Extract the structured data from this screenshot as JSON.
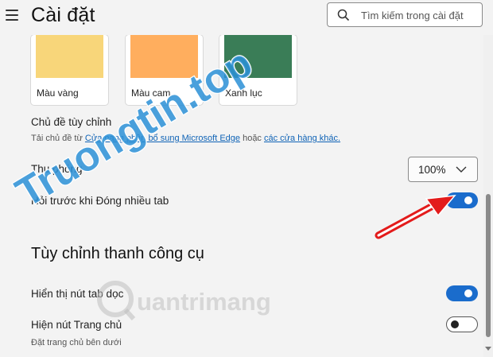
{
  "header": {
    "title": "Cài đặt",
    "search_placeholder": "Tìm kiếm trong cài đặt"
  },
  "themes": [
    {
      "label": "Màu vàng",
      "color": "#f8d67a"
    },
    {
      "label": "Màu cam",
      "color": "#ffae5e"
    },
    {
      "label": "Xanh lục",
      "color": "#3a7d57"
    }
  ],
  "custom_theme": {
    "label": "Chủ đề tùy chỉnh",
    "desc_prefix": "Tải chủ đề từ",
    "link1": "Cửa hàng phần bổ sung Microsoft Edge",
    "desc_mid": "hoặc",
    "link2": "các cửa hàng khác."
  },
  "zoom": {
    "label": "Thu phóng",
    "value": "100%"
  },
  "ask_before_close": {
    "label": "Hỏi trước khi Đóng nhiều tab",
    "enabled": true
  },
  "toolbar_section": {
    "title": "Tùy chỉnh thanh công cụ"
  },
  "vertical_tabs_button": {
    "label": "Hiển thị nút tab dọc",
    "enabled": true
  },
  "home_button": {
    "label": "Hiện nút Trang chủ",
    "sub": "Đặt trang chủ bên dưới",
    "enabled": false
  },
  "watermarks": {
    "main": "Truongtin.top",
    "secondary": "uantrimang"
  },
  "colors": {
    "accent": "#1a6ccc",
    "link": "#0f63b6",
    "watermark": "#2a8fd6",
    "arrow": "#e31b1b"
  }
}
